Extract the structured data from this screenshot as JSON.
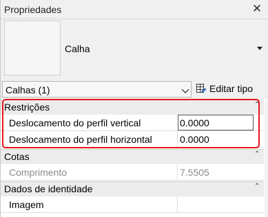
{
  "panel": {
    "title": "Propriedades"
  },
  "type_selector": {
    "family_name": "Calha"
  },
  "instance": {
    "selected": "Calhas (1)",
    "edit_type_label": "Editar tipo"
  },
  "sections": [
    {
      "label": "Restrições",
      "rows": [
        {
          "name": "Deslocamento do perfil vertical",
          "value": "0.0000"
        },
        {
          "name": "Deslocamento do perfil horizontal",
          "value": "0.0000"
        }
      ]
    },
    {
      "label": "Cotas",
      "rows": [
        {
          "name": "Comprimento",
          "value": "7.5505"
        }
      ]
    },
    {
      "label": "Dados de identidade",
      "rows": [
        {
          "name": "Imagem",
          "value": ""
        }
      ]
    }
  ],
  "highlight_color": "#e8141b"
}
